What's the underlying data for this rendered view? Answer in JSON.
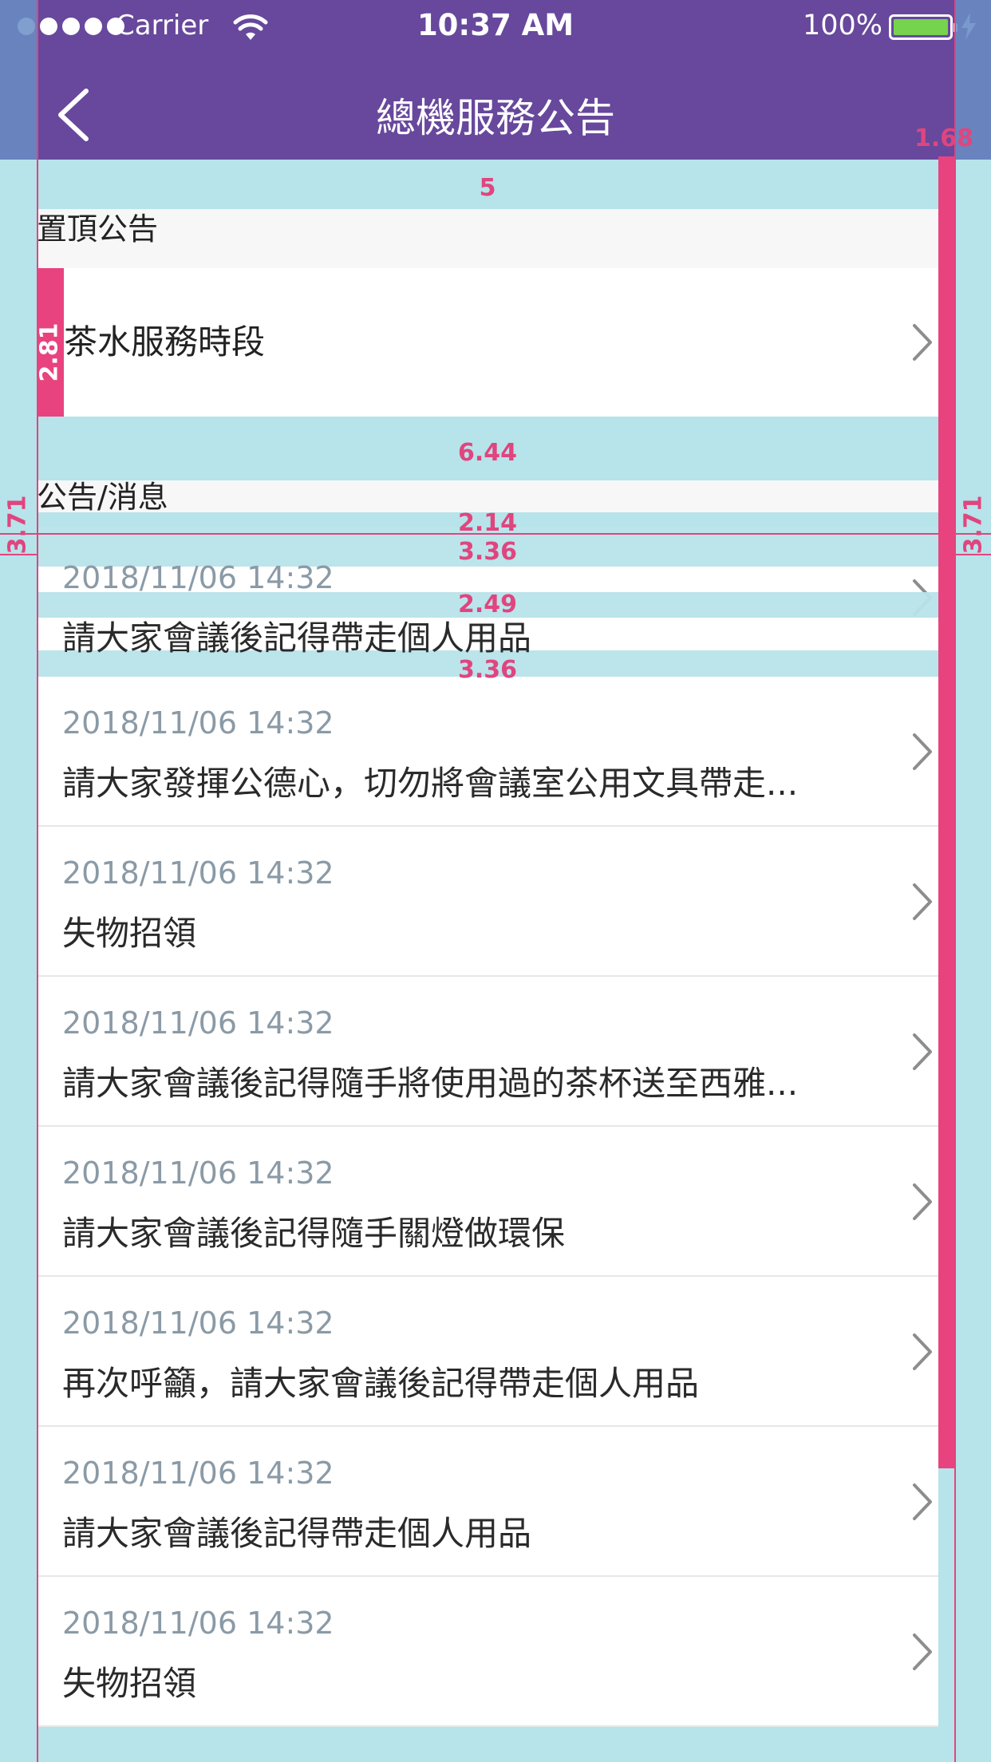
{
  "status_bar": {
    "carrier": "Carrier",
    "time": "10:37 AM",
    "battery": "100%"
  },
  "nav": {
    "title": "總機服務公告"
  },
  "sections": {
    "pinned_header": "置頂公告",
    "messages_header": "公告/消息"
  },
  "pinned_items": [
    {
      "title": "茶水服務時段"
    }
  ],
  "announcements": [
    {
      "date": "2018/11/06 14:32",
      "text": "請大家會議後記得帶走個人用品"
    },
    {
      "date": "2018/11/06 14:32",
      "text": "請大家發揮公德心，切勿將會議室公用文具帶走..."
    },
    {
      "date": "2018/11/06 14:32",
      "text": "失物招領"
    },
    {
      "date": "2018/11/06 14:32",
      "text": "請大家會議後記得隨手將使用過的茶杯送至西雅..."
    },
    {
      "date": "2018/11/06 14:32",
      "text": "請大家會議後記得隨手關燈做環保"
    },
    {
      "date": "2018/11/06 14:32",
      "text": "再次呼籲，請大家會議後記得帶走個人用品"
    },
    {
      "date": "2018/11/06 14:32",
      "text": "請大家會議後記得帶走個人用品"
    },
    {
      "date": "2018/11/06 14:32",
      "text": "失物招領"
    }
  ],
  "measurements": {
    "m_168": "1.68",
    "m_5": "5",
    "m_281": "2.81",
    "m_644": "6.44",
    "m_371_left": "3.71",
    "m_371_right": "3.71",
    "m_214": "2.14",
    "m_336_a": "3.36",
    "m_249": "2.49",
    "m_336_b": "3.36"
  },
  "colors": {
    "nav_background": "#67489c",
    "overlay_cyan": "#b7e3ea",
    "overlay_pink": "#e8437f",
    "date_text": "#8a9aa6"
  }
}
